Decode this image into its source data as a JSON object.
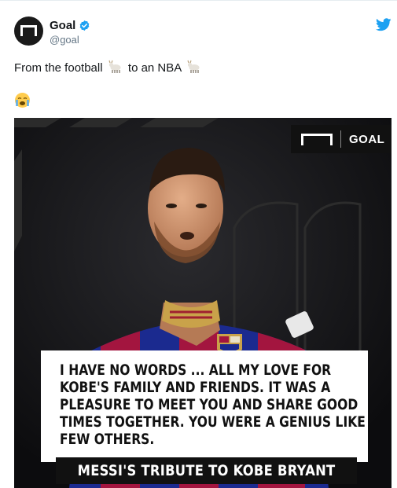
{
  "tweet": {
    "display_name": "Goal",
    "handle": "@goal",
    "text_part1": "From the football",
    "text_part2": "to an NBA"
  },
  "icons": {
    "verified": "verified-badge-icon",
    "platform": "twitter-bird-icon",
    "emoji_1": "goat-emoji",
    "emoji_2": "goat-emoji",
    "emoji_3": "loudly-crying-face-emoji"
  },
  "media": {
    "brand": "GOAL",
    "quote": "I have no words ... All my love for Kobe's family and friends. It was a pleasure to meet you and share good times together. You were a genius like few others.",
    "caption": "MESSI'S TRIBUTE TO KOBE BRYANT"
  },
  "colors": {
    "brand_blue": "#1da1f2",
    "text": "#14171a",
    "muted": "#657786",
    "barca_blue": "#1b2a8f",
    "barca_red": "#a3153f"
  }
}
